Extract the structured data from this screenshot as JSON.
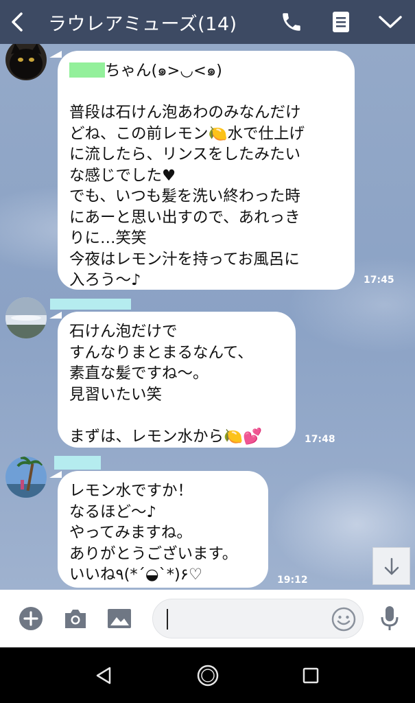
{
  "header": {
    "title": "ラウレアミューズ(14)",
    "icons": [
      "back-icon",
      "phone-icon",
      "notes-icon",
      "chevron-down-icon"
    ]
  },
  "messages": [
    {
      "sender": "",
      "lines": [
        "ちゃん(๑>◡<๑)",
        "",
        "普段は石けん泡あわのみなんだけ",
        "どね、この前レモン🍋水で仕上げ",
        "に流したら、リンスをしたみたい",
        "な感じでした♥",
        "でも、いつも髪を洗い終わった時",
        "にあーと思い出すので、あれっき",
        "りに…笑笑",
        "今夜はレモン汁を持ってお風呂に",
        "入ろう〜♪"
      ],
      "time": "17:45"
    },
    {
      "sender": "",
      "lines": [
        "石けん泡だけで",
        "すんなりまとまるなんて、",
        "素直な髪ですね〜。",
        "見習いたい笑",
        "",
        "まずは、レモン水から🍋💕"
      ],
      "time": "17:48"
    },
    {
      "sender": "",
      "lines": [
        "レモン水ですか！",
        "なるほど〜♪",
        "やってみますね。",
        "ありがとうございます。",
        "いいね٩(*´◒`*)۶♡"
      ],
      "time": "19:12"
    }
  ],
  "input": {
    "placeholder": "",
    "icons": [
      "add-icon",
      "camera-icon",
      "image-icon",
      "emoji-icon",
      "mic-icon"
    ]
  },
  "colors": {
    "header_bg": "#3d4a63",
    "chat_bg": "#8aa2c6",
    "bubble_bg": "#ffffff",
    "name_highlight": "#b5ecef",
    "mention_highlight": "#93f09b"
  }
}
